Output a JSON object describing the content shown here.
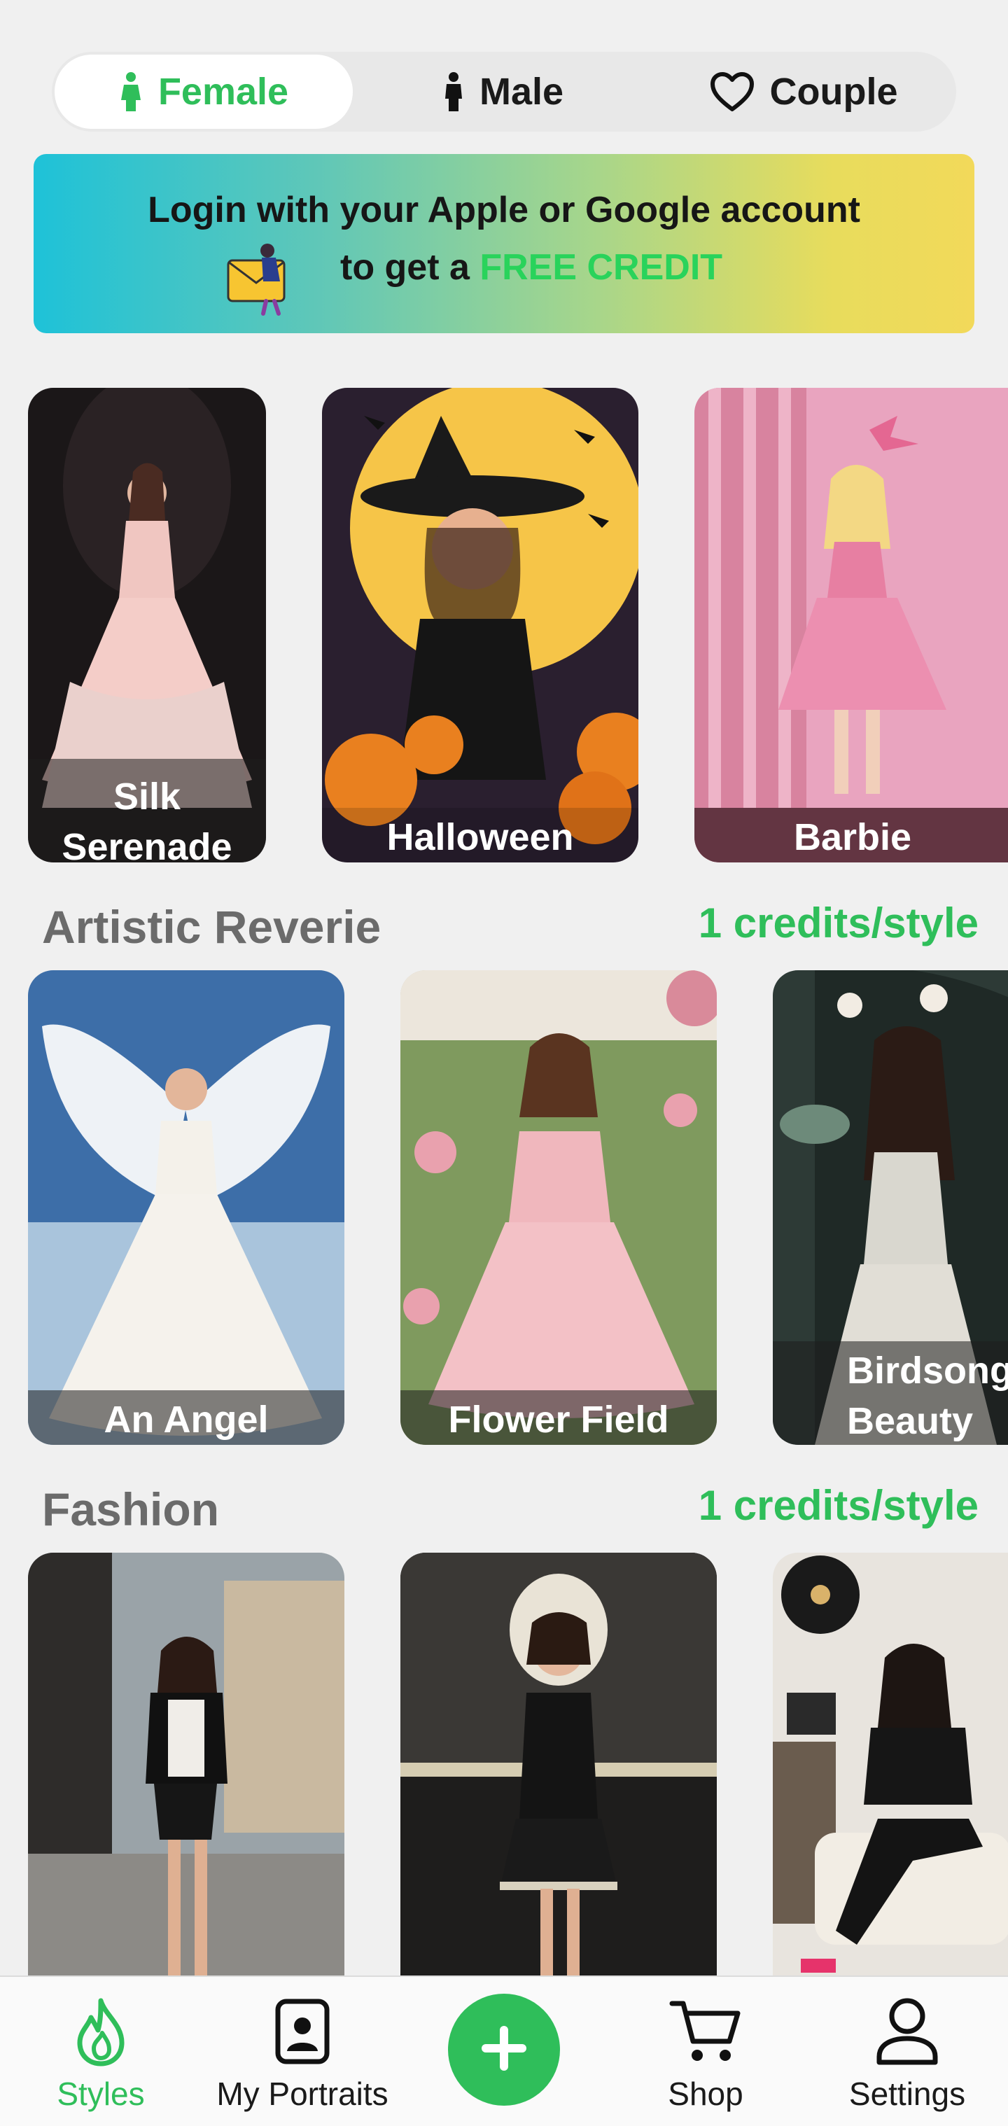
{
  "gender_tabs": [
    {
      "label": "Female",
      "icon": "female-figure-icon",
      "active": true
    },
    {
      "label": "Male",
      "icon": "male-figure-icon",
      "active": false
    },
    {
      "label": "Couple",
      "icon": "heart-icon",
      "active": false
    }
  ],
  "banner": {
    "line1": "Login with your Apple or Google account",
    "line2_prefix": "to get a ",
    "line2_highlight": "FREE CREDIT",
    "highlight_color": "#29d35b"
  },
  "featured": [
    {
      "caption": "Silk Serenade"
    },
    {
      "caption": "Halloween"
    },
    {
      "caption": "Barbie"
    }
  ],
  "sections": [
    {
      "title": "Artistic Reverie",
      "credits": "1 credits/style",
      "cards": [
        {
          "caption": "An Angel"
        },
        {
          "caption": "Flower Field"
        },
        {
          "caption": "Birdsong Beauty"
        }
      ]
    },
    {
      "title": "Fashion",
      "credits": "1 credits/style",
      "cards": [
        {
          "caption": ""
        },
        {
          "caption": ""
        },
        {
          "caption": ""
        }
      ]
    }
  ],
  "nav": {
    "items": [
      {
        "label": "Styles",
        "icon": "flame-icon",
        "active": true
      },
      {
        "label": "My Portraits",
        "icon": "portrait-icon",
        "active": false
      },
      {
        "label": "Shop",
        "icon": "cart-icon",
        "active": false
      },
      {
        "label": "Settings",
        "icon": "user-icon",
        "active": false
      }
    ],
    "fab_icon": "plus-icon"
  },
  "colors": {
    "accent": "#2fbe5a",
    "background": "#f0f0f0"
  }
}
